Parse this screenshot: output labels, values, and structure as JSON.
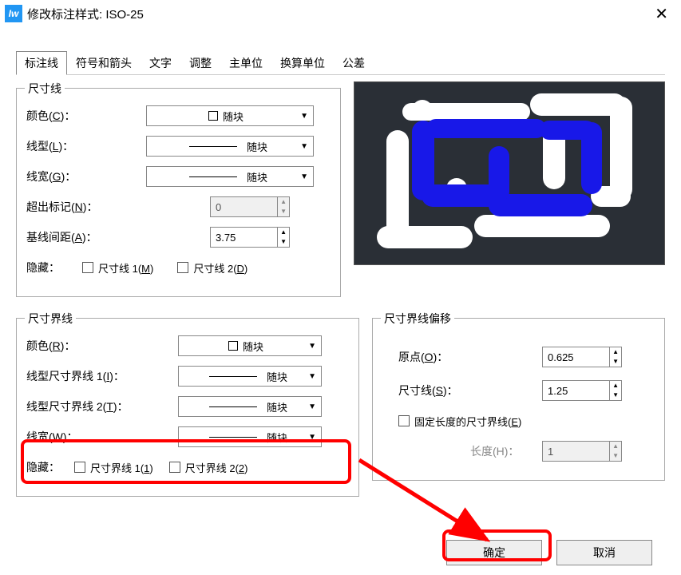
{
  "window": {
    "title": "修改标注样式: ISO-25"
  },
  "tabs": [
    "标注线",
    "符号和箭头",
    "文字",
    "调整",
    "主单位",
    "换算单位",
    "公差"
  ],
  "activeTab": 0,
  "dimLine": {
    "legend": "尺寸线",
    "colorLabel": "颜色(C)：",
    "colorValue": "随块",
    "linetypeLabel": "线型(L)：",
    "linetypeValue": "随块",
    "lineweightLabel": "线宽(G)：",
    "lineweightValue": "随块",
    "extendLabel": "超出标记(N)：",
    "extendValue": "0",
    "baselineLabel": "基线间距(A)：",
    "baselineValue": "3.75",
    "hideLabel": "隐藏：",
    "hide1": "尺寸线 1(M)",
    "hide2": "尺寸线 2(D)"
  },
  "extLine": {
    "legend": "尺寸界线",
    "colorLabel": "颜色(R)：",
    "colorValue": "随块",
    "lt1Label": "线型尺寸界线 1(I)：",
    "lt1Value": "随块",
    "lt2Label": "线型尺寸界线 2(T)：",
    "lt2Value": "随块",
    "lwLabel": "线宽(W)：",
    "lwValue": "随块",
    "hideLabel": "隐藏：",
    "hide1": "尺寸界线 1(1)",
    "hide2": "尺寸界线 2(2)"
  },
  "offset": {
    "legend": "尺寸界线偏移",
    "originLabel": "原点(O)：",
    "originValue": "0.625",
    "dimLabel": "尺寸线(S)：",
    "dimValue": "1.25",
    "fixedLabel": "固定长度的尺寸界线(E)",
    "lenLabel": "长度(H)：",
    "lenValue": "1"
  },
  "buttons": {
    "ok": "确定",
    "cancel": "取消"
  }
}
